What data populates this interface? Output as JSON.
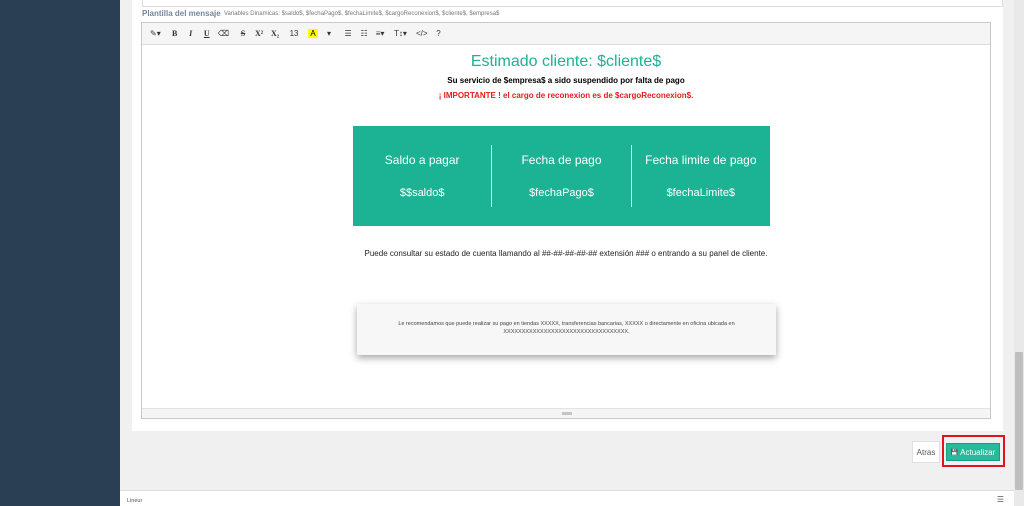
{
  "template_label": "Plantilla del mensaje",
  "variables_hint": "Variables Dinamicas: $saldo$, $fechaPago$, $fechaLimite$, $cargoReconexion$, $cliente$, $empresa$",
  "toolbar": {
    "items": [
      "✎▾",
      "B",
      "I",
      "U",
      "⌫",
      "S",
      "X²",
      "X₂",
      "13",
      "A",
      "▾",
      "☰",
      "☷",
      "≡▾",
      "T↕▾",
      "</>",
      "?"
    ]
  },
  "editor": {
    "title": "Estimado cliente: $cliente$",
    "line1": "Su servicio de $empresa$ a sido suspendido por falta de pago",
    "line2": "¡ IMPORTANTE ! el cargo de reconexion es de $cargoReconexion$.",
    "columns": [
      {
        "head": "Saldo a pagar",
        "val": "$$saldo$"
      },
      {
        "head": "Fecha de pago",
        "val": "$fechaPago$"
      },
      {
        "head": "Fecha limite de pago",
        "val": "$fechaLimite$"
      }
    ],
    "paragraph": "Puede consultar su estado de cuenta llamando al ##-##-##-##-## extensión ### o entrando a su panel de cliente.",
    "note": "Le recomendamos que puede realizar su pago en tiendas XXXXX, transferencias bancarias, XXXXX o directamente en oficina ubicada en XXXXXXXXXXXXXXXXXXXXXXXXXXXXXXXXXX."
  },
  "buttons": {
    "back": "Atras",
    "update": "Actualizar",
    "update_icon": "💾"
  },
  "footer": {
    "text": "Lineur"
  },
  "colors": {
    "accent": "#1bb394",
    "button": "#26b99a",
    "alert": "#e81a1a",
    "sidebar": "#2a3f54",
    "highlight": "#e0141a"
  }
}
